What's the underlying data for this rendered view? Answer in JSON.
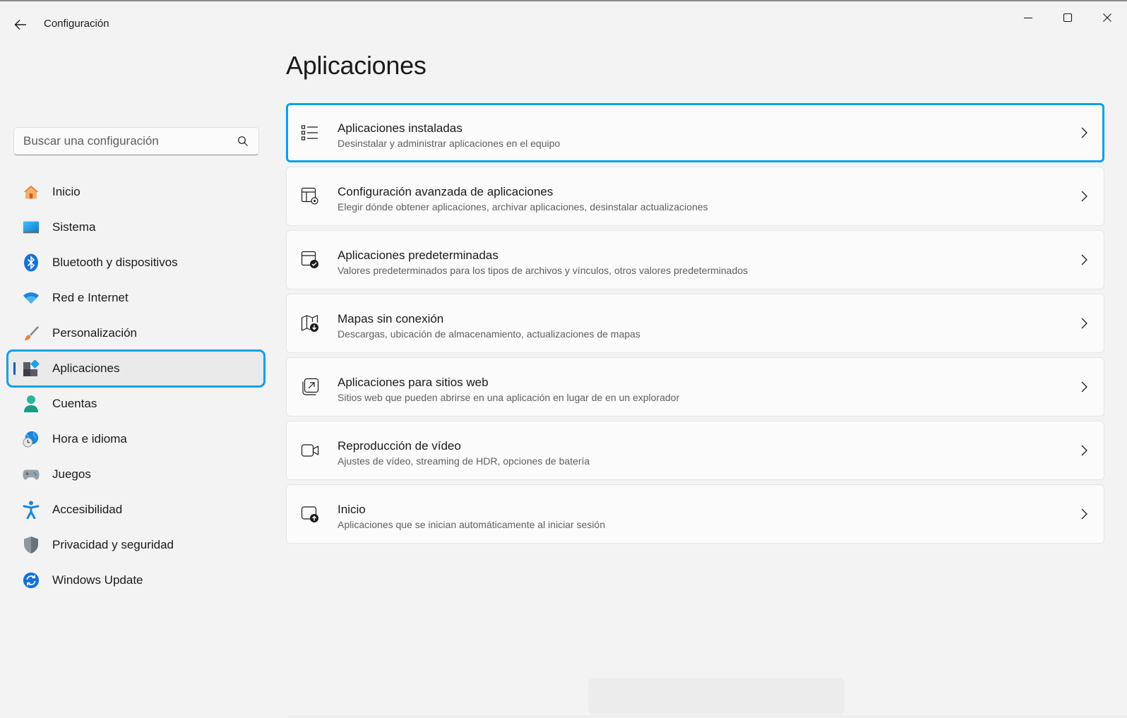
{
  "window": {
    "title": "Configuración"
  },
  "search": {
    "placeholder": "Buscar una configuración"
  },
  "sidebar": {
    "items": [
      {
        "label": "Inicio",
        "icon": "home-icon"
      },
      {
        "label": "Sistema",
        "icon": "system-icon"
      },
      {
        "label": "Bluetooth y dispositivos",
        "icon": "bluetooth-icon"
      },
      {
        "label": "Red e Internet",
        "icon": "wifi-icon"
      },
      {
        "label": "Personalización",
        "icon": "brush-icon"
      },
      {
        "label": "Aplicaciones",
        "icon": "apps-icon",
        "selected": true
      },
      {
        "label": "Cuentas",
        "icon": "account-icon"
      },
      {
        "label": "Hora e idioma",
        "icon": "globe-clock-icon"
      },
      {
        "label": "Juegos",
        "icon": "gamepad-icon"
      },
      {
        "label": "Accesibilidad",
        "icon": "accessibility-icon"
      },
      {
        "label": "Privacidad y seguridad",
        "icon": "shield-icon"
      },
      {
        "label": "Windows Update",
        "icon": "update-icon"
      }
    ]
  },
  "main": {
    "title": "Aplicaciones",
    "cards": [
      {
        "title": "Aplicaciones instaladas",
        "subtitle": "Desinstalar y administrar aplicaciones en el equipo",
        "icon": "list-icon"
      },
      {
        "title": "Configuración avanzada de aplicaciones",
        "subtitle": "Elegir dónde obtener aplicaciones, archivar aplicaciones, desinstalar actualizaciones",
        "icon": "app-settings-icon"
      },
      {
        "title": "Aplicaciones predeterminadas",
        "subtitle": "Valores predeterminados para los tipos de archivos y vínculos, otros valores predeterminados",
        "icon": "default-apps-icon"
      },
      {
        "title": "Mapas sin conexión",
        "subtitle": "Descargas, ubicación de almacenamiento, actualizaciones de mapas",
        "icon": "offline-map-icon"
      },
      {
        "title": "Aplicaciones para sitios web",
        "subtitle": "Sitios web que pueden abrirse en una aplicación en lugar de en un explorador",
        "icon": "web-apps-icon"
      },
      {
        "title": "Reproducción de vídeo",
        "subtitle": "Ajustes de vídeo, streaming de HDR, opciones de batería",
        "icon": "video-icon"
      },
      {
        "title": "Inicio",
        "subtitle": "Aplicaciones que se inician automáticamente al iniciar sesión",
        "icon": "startup-icon"
      }
    ]
  },
  "colors": {
    "accent": "#005fb8",
    "focus_ring": "#0aa0ea",
    "background": "#f3f3f3",
    "card": "#fbfbfb"
  }
}
